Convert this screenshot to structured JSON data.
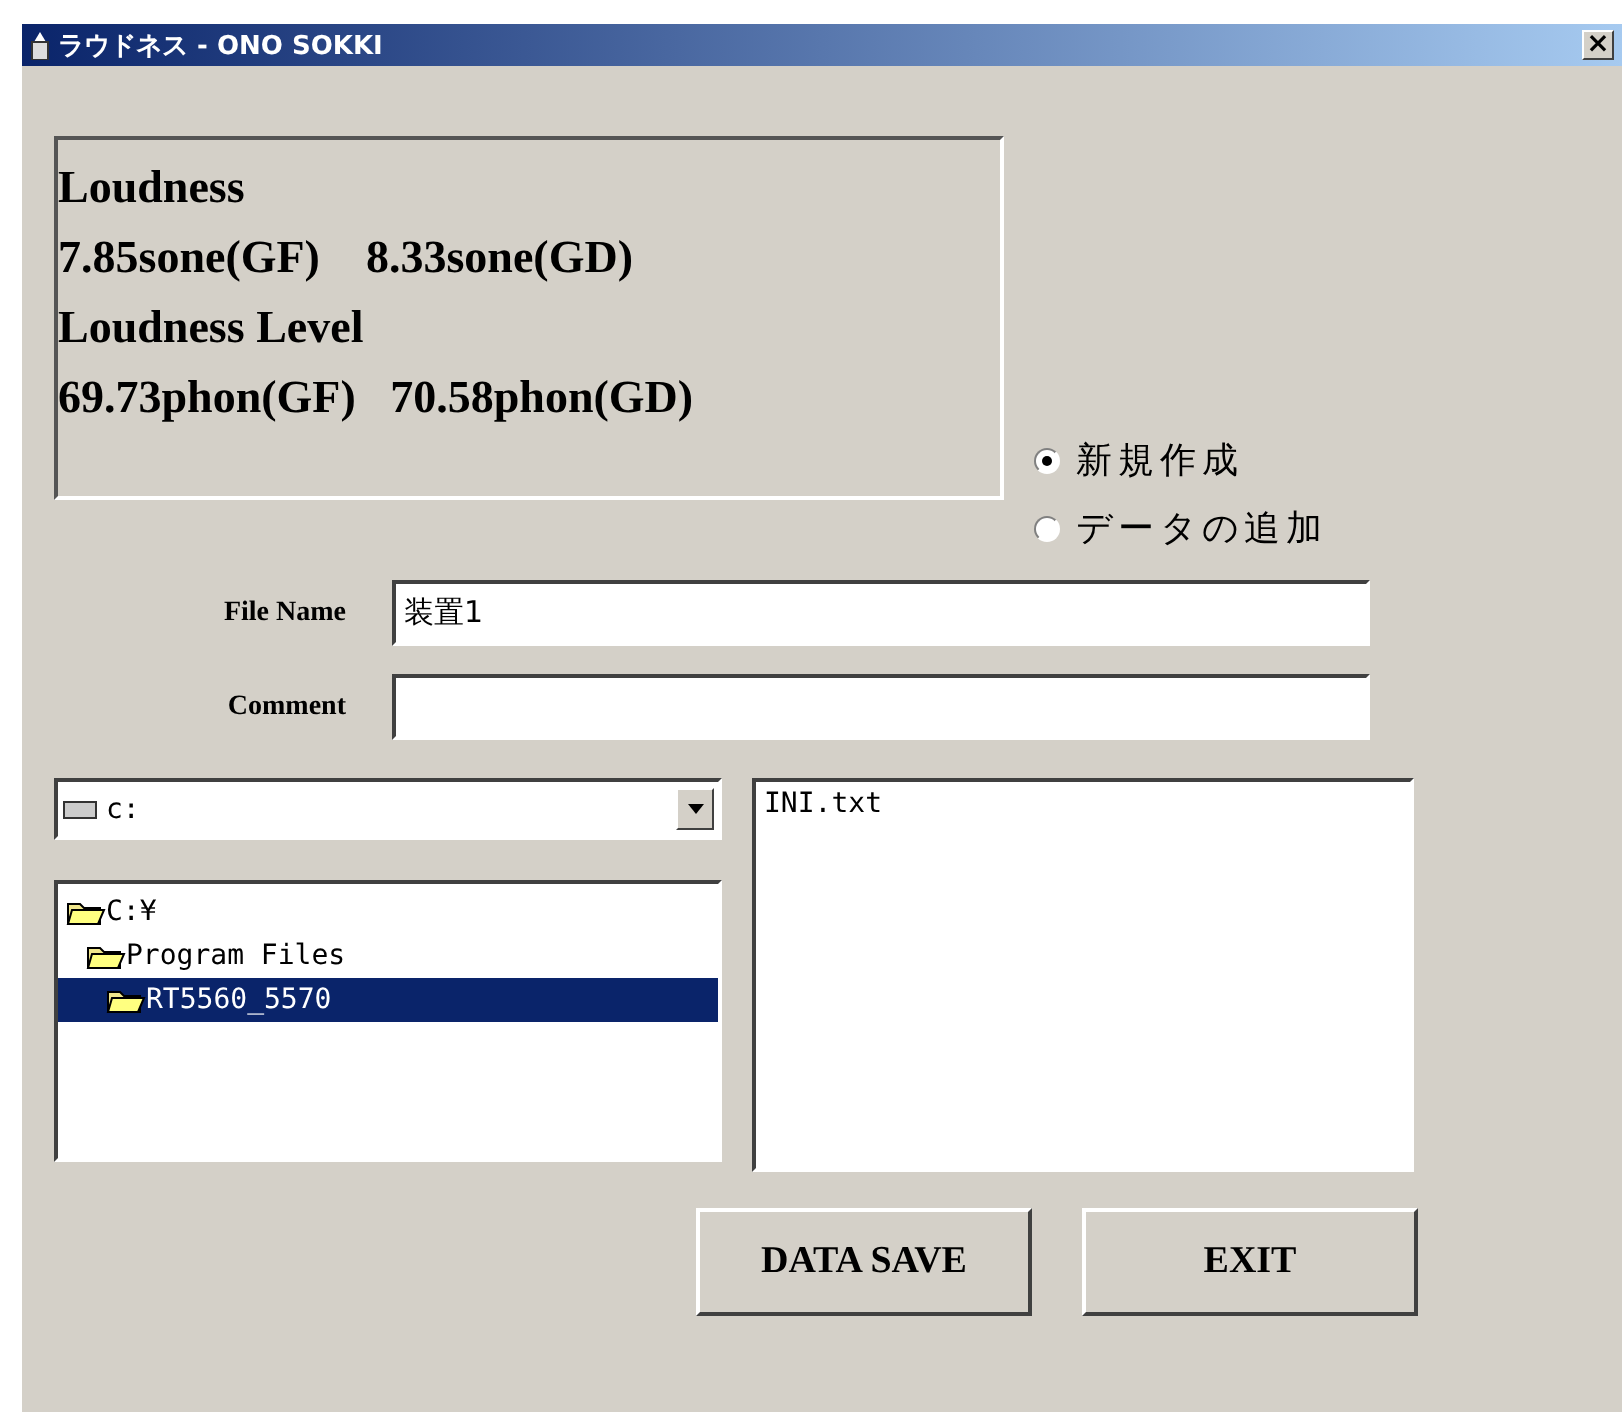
{
  "window": {
    "title": "ラウドネス - ONO SOKKI",
    "close": "×"
  },
  "results": [
    "Loudness",
    "7.85sone(GF)    8.33sone(GD)",
    "Loudness Level",
    "69.73phon(GF)   70.58phon(GD)"
  ],
  "mode_options": [
    {
      "label": "新規作成",
      "selected": true
    },
    {
      "label": "データの追加",
      "selected": false
    }
  ],
  "fields": [
    {
      "label": "File Name",
      "value": "装置1"
    },
    {
      "label": "Comment"
    }
  ],
  "drive": {
    "value": "c:"
  },
  "folders": [
    {
      "name": "C:¥",
      "selected": false,
      "children": [
        {
          "name": "Program Files",
          "selected": false,
          "children": [
            {
              "name": "RT5560_5570",
              "selected": true
            }
          ]
        }
      ]
    }
  ],
  "files": [
    {
      "name": "INI.txt",
      "selected": false
    }
  ],
  "buttons": [
    "DATA SAVE",
    "EXIT"
  ]
}
